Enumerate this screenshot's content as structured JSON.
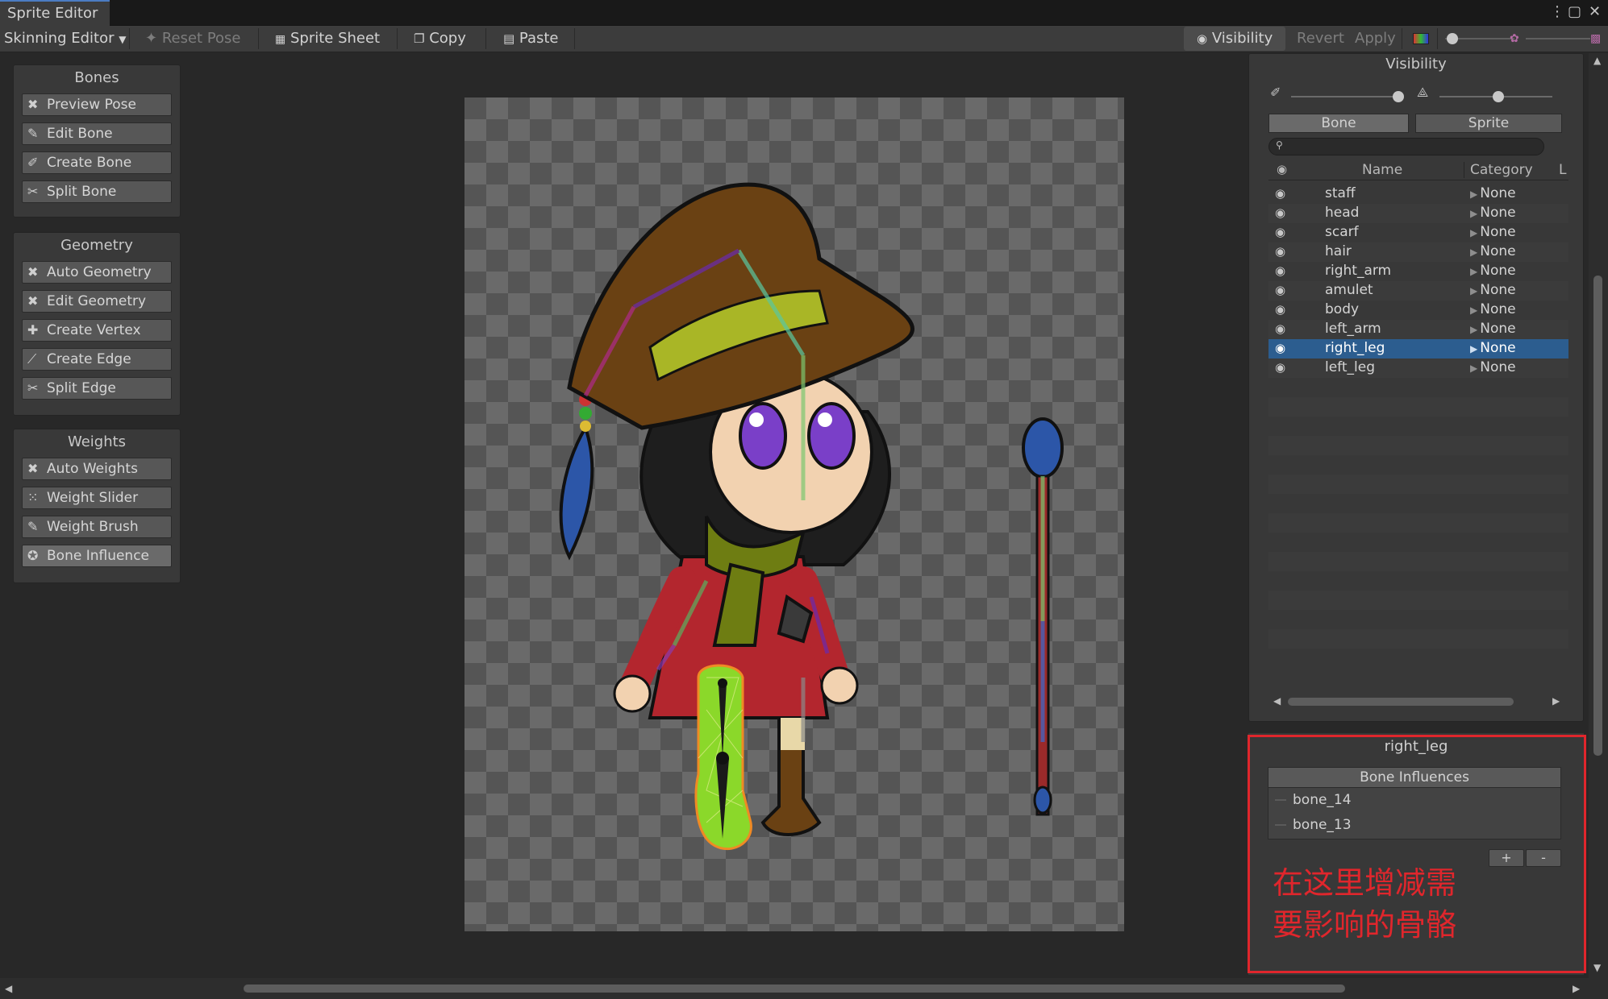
{
  "window": {
    "title": "Sprite Editor"
  },
  "toolbar": {
    "mode": "Skinning Editor",
    "reset_pose": "Reset Pose",
    "sprite_sheet": "Sprite Sheet",
    "copy": "Copy",
    "paste": "Paste",
    "visibility": "Visibility",
    "revert": "Revert",
    "apply": "Apply"
  },
  "bones_panel": {
    "title": "Bones",
    "buttons": [
      "Preview Pose",
      "Edit Bone",
      "Create Bone",
      "Split Bone"
    ]
  },
  "geometry_panel": {
    "title": "Geometry",
    "buttons": [
      "Auto Geometry",
      "Edit Geometry",
      "Create Vertex",
      "Create Edge",
      "Split Edge"
    ]
  },
  "weights_panel": {
    "title": "Weights",
    "buttons": [
      "Auto Weights",
      "Weight Slider",
      "Weight Brush",
      "Bone Influence"
    ]
  },
  "visibility_panel": {
    "title": "Visibility",
    "tabs": [
      "Bone",
      "Sprite"
    ],
    "search": {
      "value": ""
    },
    "columns": {
      "name": "Name",
      "category": "Category",
      "extra": "L"
    },
    "rows": [
      {
        "name": "staff",
        "category": "None"
      },
      {
        "name": "head",
        "category": "None"
      },
      {
        "name": "scarf",
        "category": "None"
      },
      {
        "name": "hair",
        "category": "None"
      },
      {
        "name": "right_arm",
        "category": "None"
      },
      {
        "name": "amulet",
        "category": "None"
      },
      {
        "name": "body",
        "category": "None"
      },
      {
        "name": "left_arm",
        "category": "None"
      },
      {
        "name": "right_leg",
        "category": "None"
      },
      {
        "name": "left_leg",
        "category": "None"
      }
    ],
    "selected_row": "right_leg"
  },
  "influence_panel": {
    "title": "right_leg",
    "header": "Bone Influences",
    "bones": [
      "bone_14",
      "bone_13"
    ],
    "add_label": "+",
    "remove_label": "-",
    "note_line1": "在这里增减需",
    "note_line2": "要影响的骨骼"
  },
  "colors": {
    "highlight_box": "#e0262c",
    "selection": "#2c5d8f"
  }
}
